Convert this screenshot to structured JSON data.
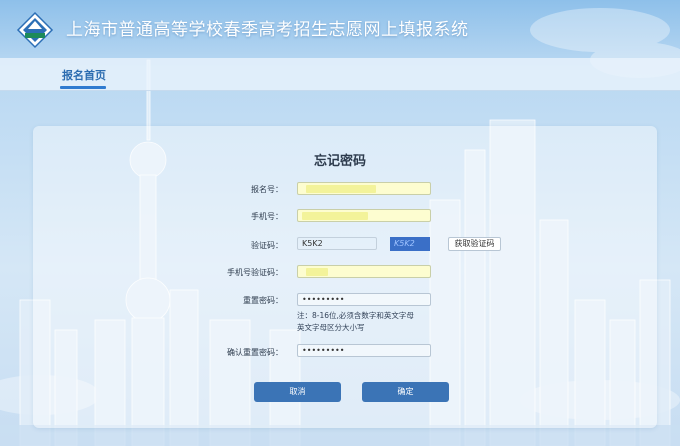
{
  "header": {
    "app_title": "上海市普通高等学校春季高考招生志愿网上填报系统"
  },
  "nav": {
    "tab_home": "报名首页"
  },
  "form": {
    "title": "忘记密码",
    "registration_no": {
      "label": "报名号：",
      "value": ""
    },
    "phone": {
      "label": "手机号：",
      "value": ""
    },
    "captcha": {
      "label": "验证码：",
      "value": "K5K2",
      "image_text": "K5K2",
      "sms_button": "获取验证码"
    },
    "sms_code": {
      "label": "手机号验证码：",
      "value": ""
    },
    "reset_password": {
      "label": "重置密码：",
      "value": "•••••••••"
    },
    "note_line1": "注：8-16位,必须含数字和英文字母",
    "note_line2": "英文字母区分大小写",
    "confirm_password": {
      "label": "确认重置密码：",
      "value": "•••••••••"
    },
    "cancel_button": "取消",
    "confirm_button": "确定"
  },
  "colors": {
    "primary_button": "#3b74b6",
    "autofill_yellow": "#fdfdd0",
    "nav_active": "#2f7bd0"
  },
  "icons": {
    "logo": "school-emblem-icon"
  }
}
